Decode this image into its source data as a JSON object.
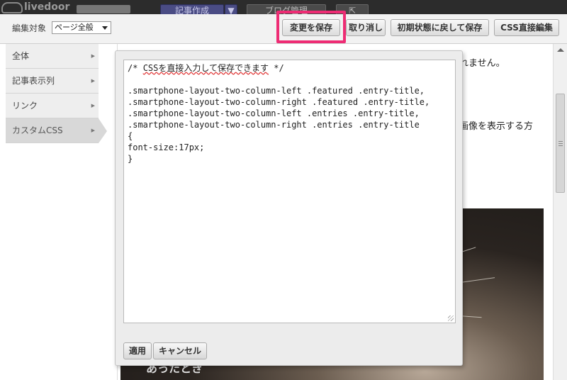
{
  "topbar": {
    "logo_text": "livedoor",
    "create_label": "記事作成",
    "create_arrow": "▼",
    "manage_label": "ブログ管理",
    "external_icon": "external-link-icon"
  },
  "toolbar": {
    "target_label": "編集対象",
    "target_value": "ページ全般",
    "save_label": "変更を保存",
    "undo_label": "取り消し",
    "reset_label": "初期状態に戻して保存",
    "cssedit_label": "CSS直接編集"
  },
  "sidebar": {
    "items": [
      {
        "label": "全体",
        "arrow": "▶"
      },
      {
        "label": "記事表示列",
        "arrow": "▶"
      },
      {
        "label": "リンク",
        "arrow": "▶"
      },
      {
        "label": "カスタムCSS",
        "arrow": "▶"
      }
    ]
  },
  "editor": {
    "comment_prefix": "/* ",
    "comment_main": "CSSを直接入力して保存できます",
    "comment_suffix": " */",
    "body": "\n\n.smartphone-layout-two-column-left .featured .entry-title,\n.smartphone-layout-two-column-right .featured .entry-title,\n.smartphone-layout-two-column-left .entries .entry-title,\n.smartphone-layout-two-column-right .entries .entry-title\n{\nfont-size:17px;\n}",
    "apply_label": "適用",
    "cancel_label": "キャンセル"
  },
  "background": {
    "text1": "れません。",
    "text2": "画像を表示する方",
    "caption": "あったとき"
  },
  "colors": {
    "highlight": "#ee2c74",
    "accent": "#4a4c84"
  }
}
